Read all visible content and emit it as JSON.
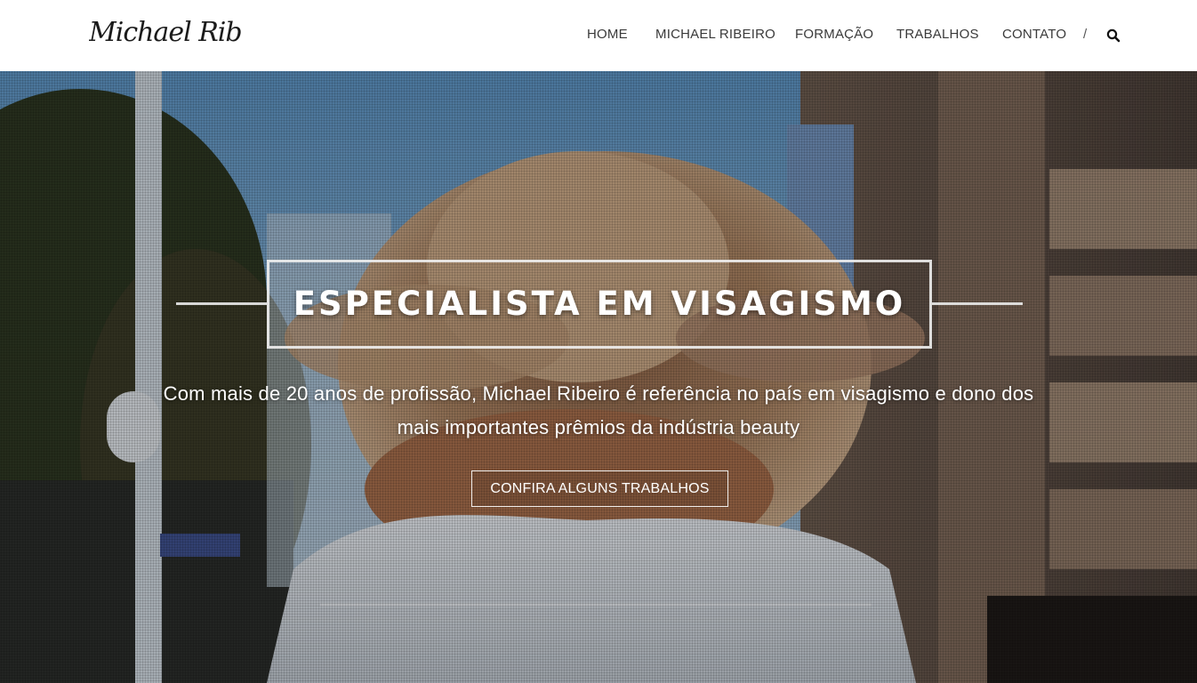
{
  "header": {
    "logo_text": "Michael Ribeiro",
    "nav": [
      {
        "label": "HOME"
      },
      {
        "label": "MICHAEL RIBEIRO"
      },
      {
        "label": "FORMAÇÃO"
      },
      {
        "label": "TRABALHOS"
      },
      {
        "label": "CONTATO"
      }
    ],
    "separator": "/",
    "search_icon": "search-icon"
  },
  "hero": {
    "title": "ESPECIALISTA EM VISAGISMO",
    "subtitle_line1": "Com mais de 20 anos de profissão, Michael Ribeiro é referência no país em visagismo e dono dos",
    "subtitle_line2": "mais importantes prêmios da indústria beauty",
    "cta_label": "CONFIRA ALGUNS TRABALHOS"
  },
  "colors": {
    "header_bg": "#ffffff",
    "nav_text": "#3a3a3a",
    "hero_text": "#ffffff",
    "sky": "#4f86b3"
  }
}
